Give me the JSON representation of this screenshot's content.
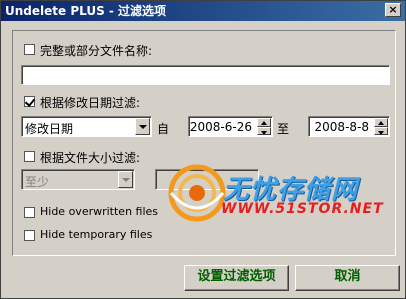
{
  "window": {
    "title": "Undelete PLUS - 过滤选项",
    "close_label": "×"
  },
  "filename_filter": {
    "checked": false,
    "label": "完整或部分文件名称:",
    "value": ""
  },
  "date_filter": {
    "checked": true,
    "label": "根据修改日期过滤:",
    "field_selected": "修改日期",
    "from_label": "自",
    "from_date": "2008-6-26",
    "to_label": "至",
    "to_date": "2008-8-8"
  },
  "size_filter": {
    "checked": false,
    "label": "根据文件大小过滤:",
    "comparator_selected": "至少",
    "value": ""
  },
  "hide_overwritten": {
    "checked": false,
    "label": "Hide overwritten files"
  },
  "hide_temporary": {
    "checked": false,
    "label": "Hide temporary files"
  },
  "buttons": {
    "apply_label": "设置过滤选项",
    "cancel_label": "取消"
  },
  "watermark": {
    "title": "无忧存储网",
    "url": "WWW.51STOR.NET"
  },
  "colors": {
    "title_bar_start": "#0a246a",
    "title_bar_end": "#3a6ea5",
    "button_text": "#006000",
    "watermark_blue": "#3ea0e6",
    "watermark_red": "#e81e1e"
  }
}
